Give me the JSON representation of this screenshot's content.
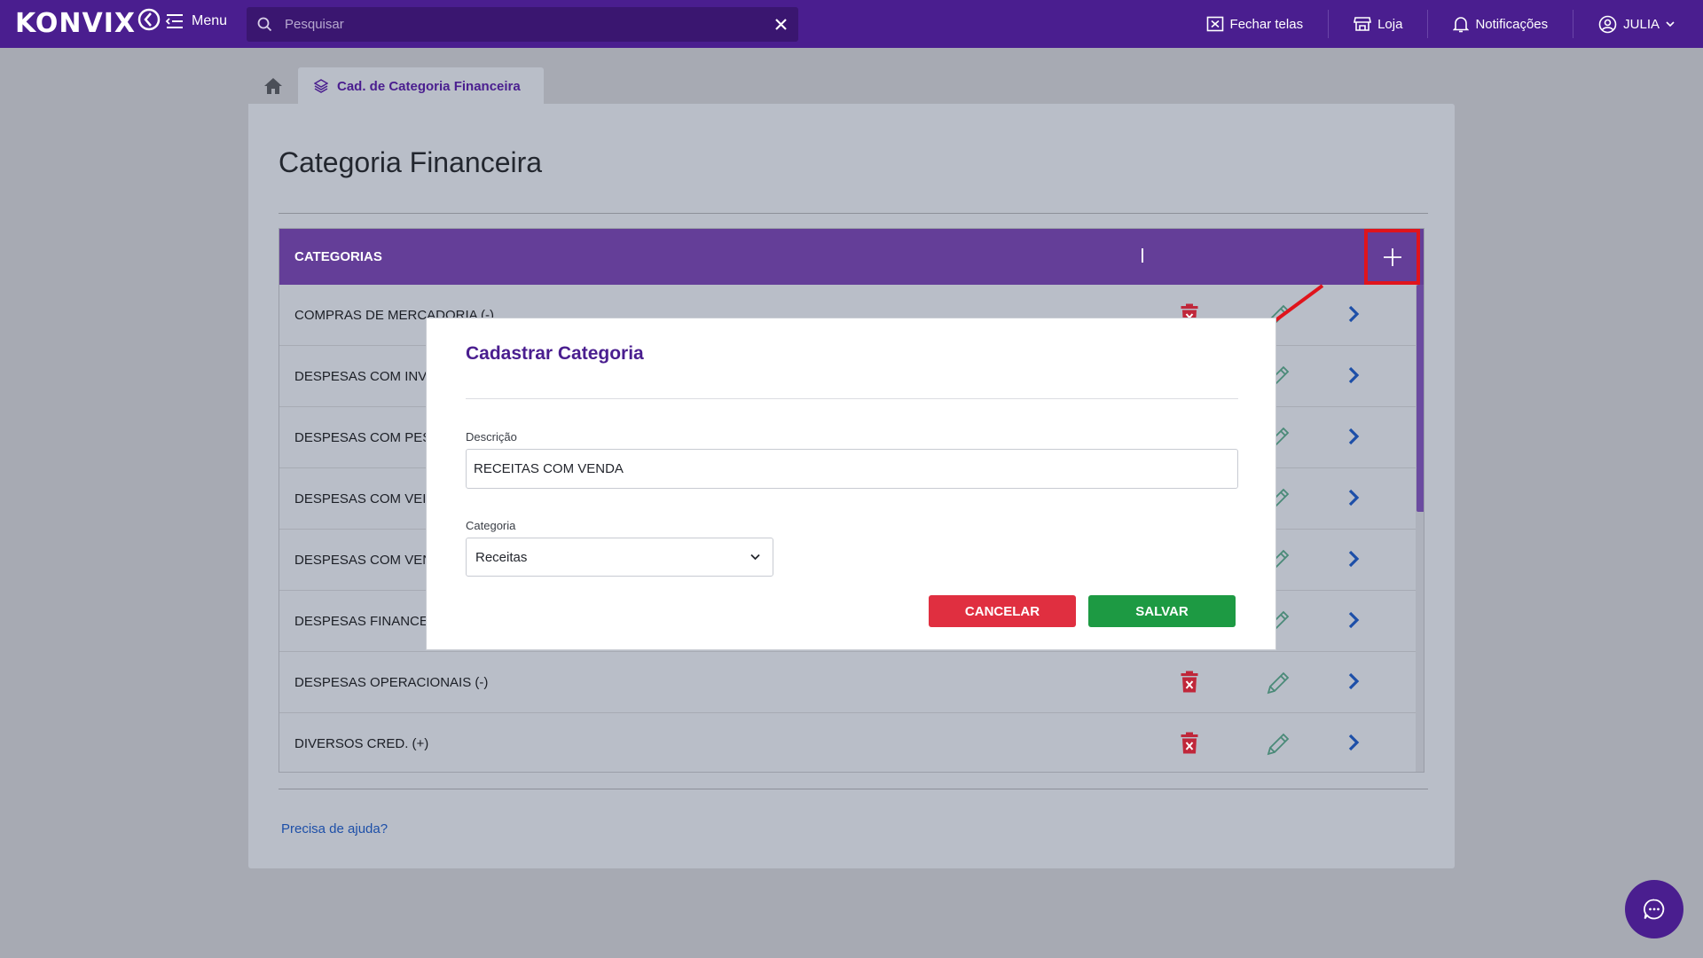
{
  "header": {
    "logo_text": "KONVIX",
    "menu_label": "Menu",
    "search": {
      "placeholder": "Pesquisar",
      "value": ""
    },
    "actions": [
      {
        "label": "Fechar telas",
        "icon": "close-window-icon"
      },
      {
        "label": "Loja",
        "icon": "store-icon"
      },
      {
        "label": "Notificações",
        "icon": "bell-icon"
      },
      {
        "label": "JULIA",
        "icon": "user-circle-icon"
      }
    ]
  },
  "tabs": {
    "home_icon": "home-icon",
    "active": {
      "label": "Cad. de Categoria Financeira",
      "icon": "layers-icon"
    }
  },
  "page": {
    "title": "Categoria Financeira",
    "help_link": "Precisa de ajuda?"
  },
  "table": {
    "header": "CATEGORIAS",
    "add_icon": "plus-icon",
    "rows": [
      {
        "name": "COMPRAS DE MERCADORIA (-)"
      },
      {
        "name": "DESPESAS COM INVE"
      },
      {
        "name": "DESPESAS COM PESS"
      },
      {
        "name": "DESPESAS COM VEIC"
      },
      {
        "name": "DESPESAS COM VENI"
      },
      {
        "name": "DESPESAS FINANCEI"
      },
      {
        "name": "DESPESAS OPERACIONAIS (-)"
      },
      {
        "name": "DIVERSOS CRED. (+)"
      }
    ]
  },
  "modal": {
    "title": "Cadastrar Categoria",
    "descricao_label": "Descrição",
    "descricao_value": "RECEITAS COM VENDA",
    "categoria_label": "Categoria",
    "categoria_value": "Receitas",
    "cancel_label": "CANCELAR",
    "save_label": "SALVAR"
  },
  "colors": {
    "brand": "#4a1e8f",
    "table_header": "#643e98",
    "delete": "#c0273a",
    "edit": "#4a8a78",
    "arrow": "#1d4fa8",
    "cancel": "#e02f40",
    "save": "#1d9a43",
    "annotation": "#e0141c"
  }
}
